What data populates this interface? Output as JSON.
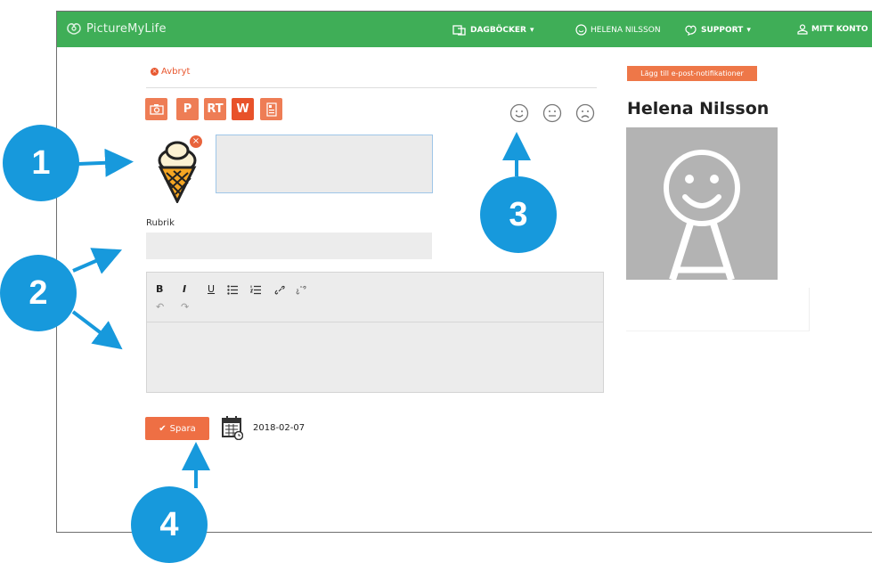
{
  "navbar": {
    "brand": "PictureMyLife",
    "diaries_label": "DAGBÖCKER",
    "user_label": "HELENA NILSSON",
    "support_label": "SUPPORT",
    "account_label": "MITT KONTO",
    "color": "#3fae57"
  },
  "entry": {
    "cancel_label": "Avbryt",
    "toolbar": {
      "photo_icon": "camera-icon",
      "p_label": "P",
      "rt_label": "RT",
      "w_label": "W",
      "template_icon": "template-icon"
    },
    "moods": [
      "smile-icon",
      "neutral-icon",
      "sad-icon"
    ],
    "picture_icon": "ice-cream-icon",
    "picture_text_value": "",
    "rubrik_label": "Rubrik",
    "rubrik_value": "",
    "editor": {
      "tools": [
        "B",
        "I",
        "U",
        "bullet-list-icon",
        "numbered-list-icon",
        "link-icon",
        "unlink-icon"
      ],
      "undo_icon": "undo-icon",
      "redo_icon": "redo-icon",
      "body_value": ""
    },
    "save_label": "Spara",
    "date": "2018-02-07"
  },
  "sidebar": {
    "notify_label": "Lägg till e-post-notifikationer",
    "user_name": "Helena Nilsson",
    "avatar_icon": "smiley-avatar-icon"
  },
  "callouts": [
    "1",
    "2",
    "3",
    "4"
  ],
  "colors": {
    "accent": "#ee7d55",
    "callout": "#1799dc"
  }
}
